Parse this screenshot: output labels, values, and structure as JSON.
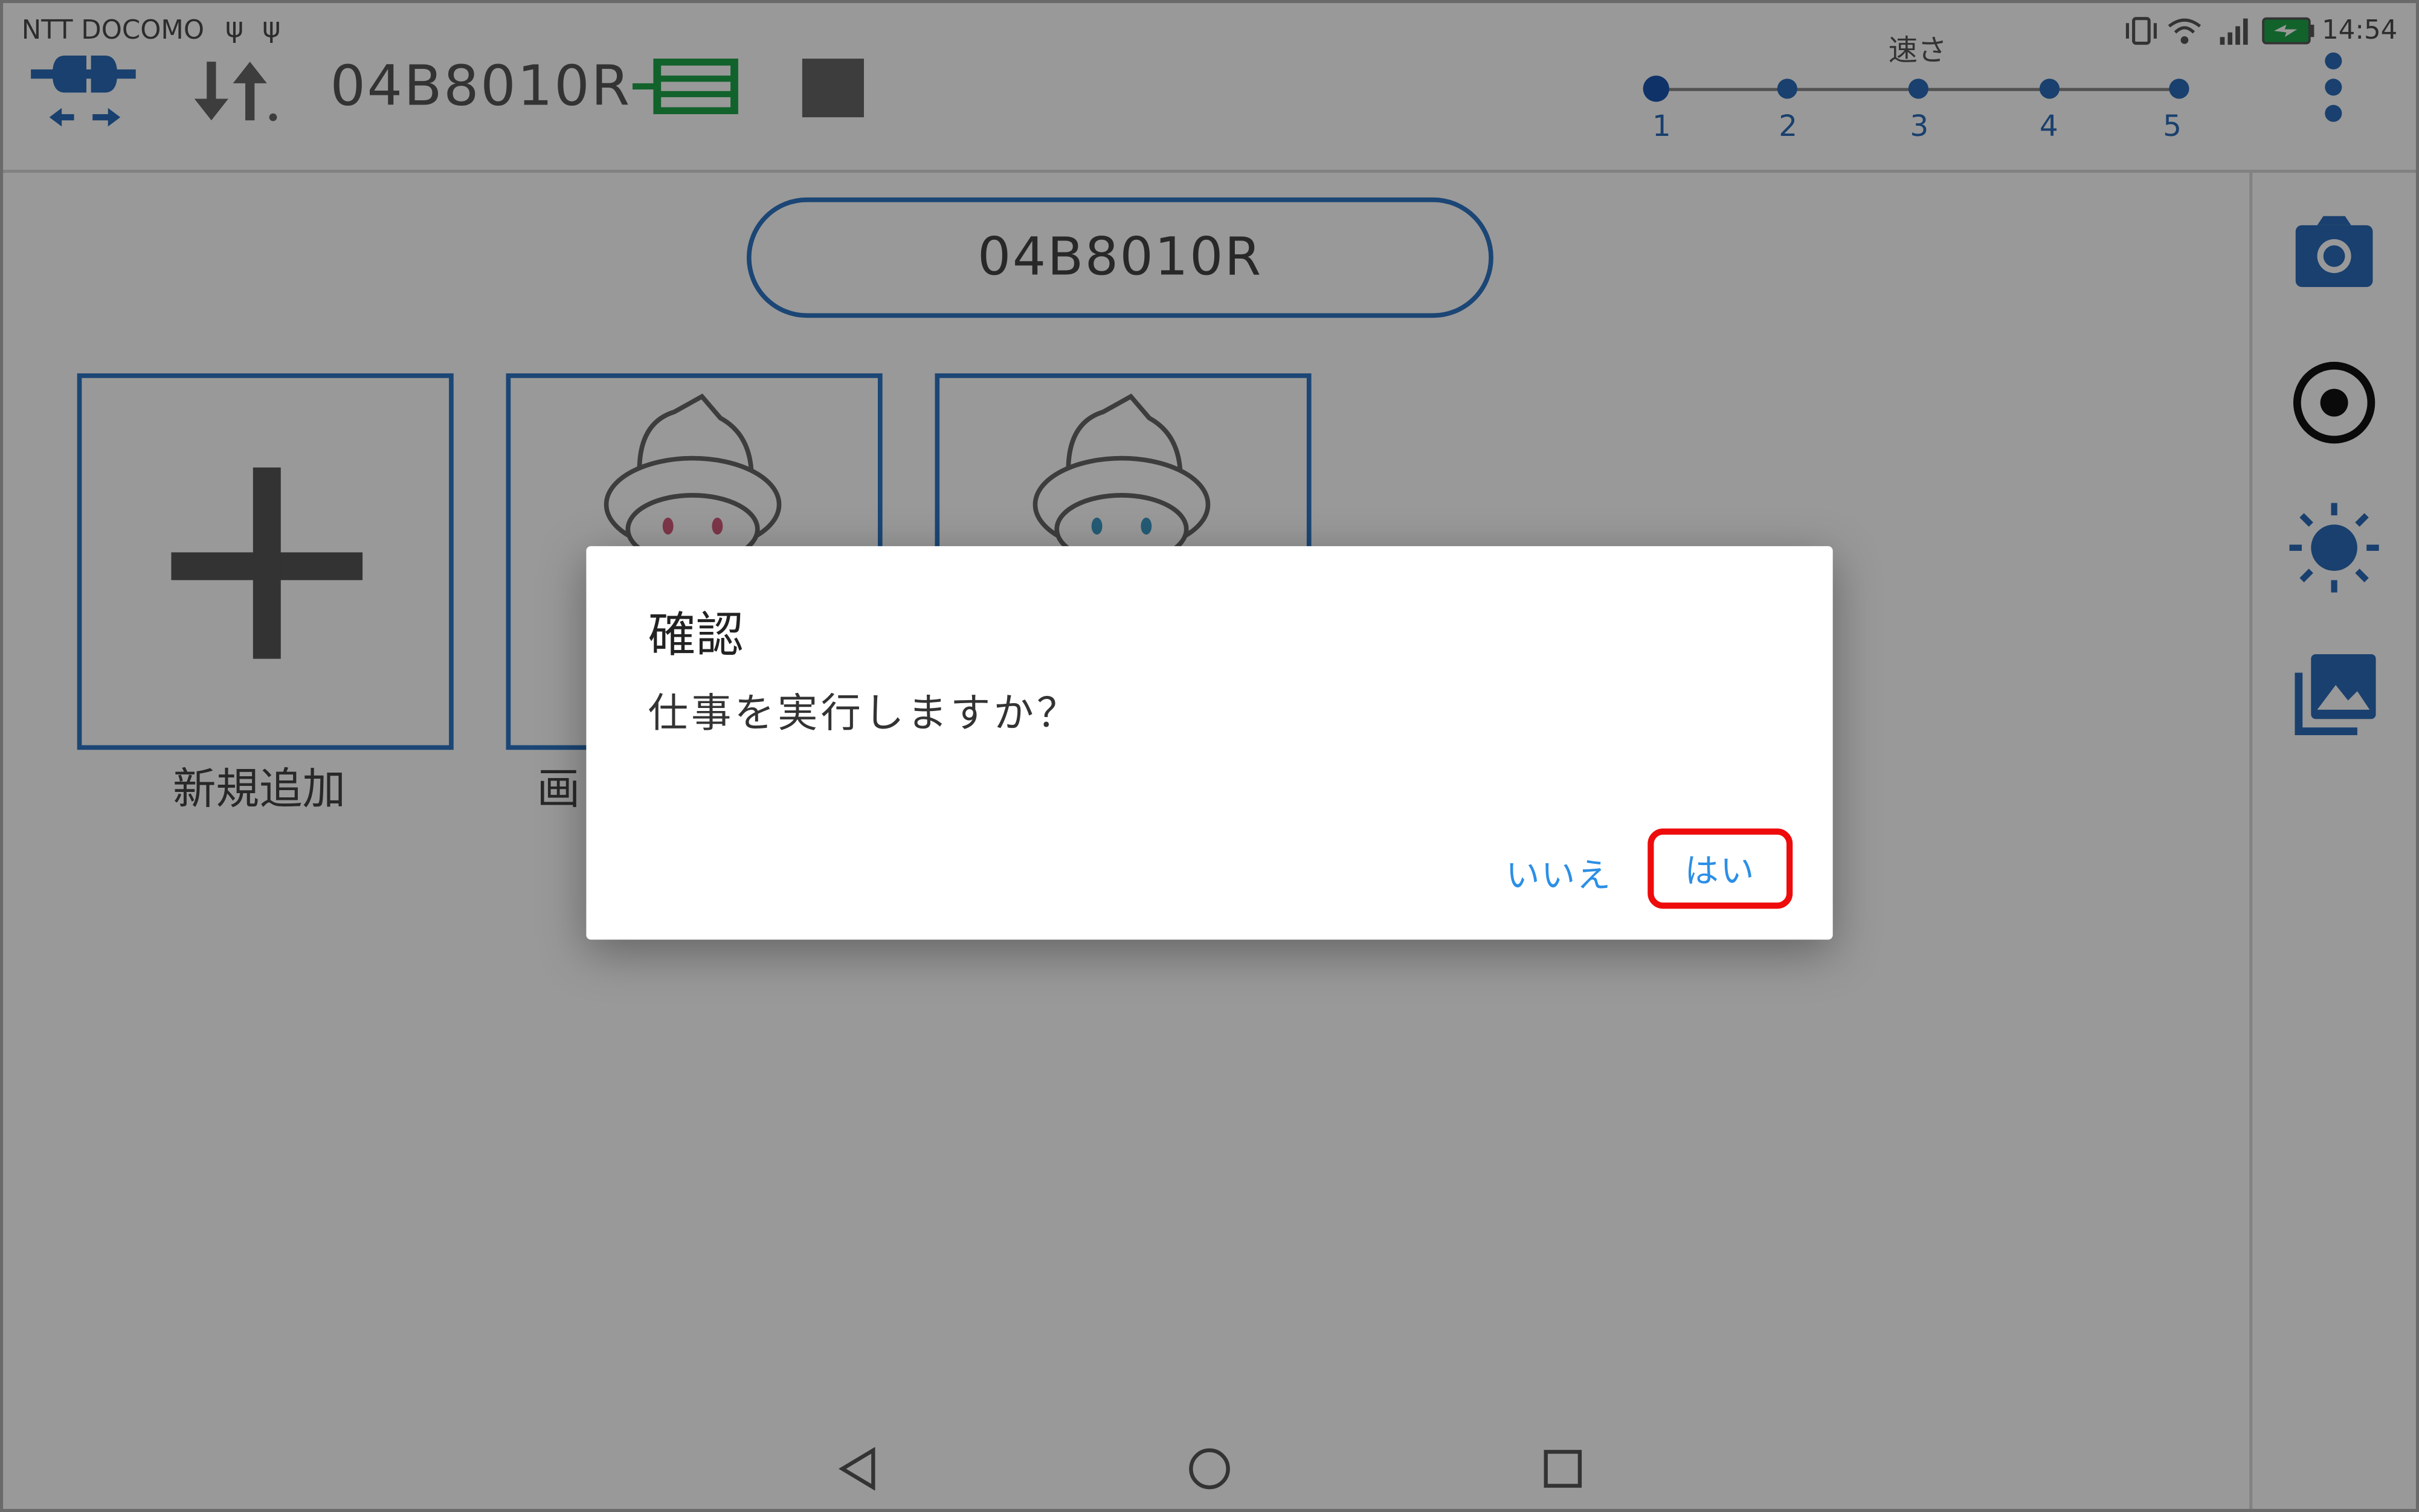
{
  "status_bar": {
    "carrier": "NTT DOCOMO",
    "usb_icons": [
      "usb-icon",
      "usb-icon"
    ],
    "right_icons": [
      "vibrate-icon",
      "wifi-icon",
      "signal-icon",
      "battery-charging-icon"
    ],
    "time": "14:54"
  },
  "toolbar": {
    "connection_icon": "plug-connect-icon",
    "sort_icon": "sort-updown-icon",
    "device_id": "04B8010R",
    "device_icon": "device-list-icon",
    "stop_icon": "stop-icon",
    "speed": {
      "label": "速さ",
      "levels": [
        "1",
        "2",
        "3",
        "4",
        "5"
      ],
      "selected": "1"
    },
    "menu_icon": "more-vert-icon"
  },
  "sidebar": {
    "buttons": [
      "camera-icon",
      "record-icon",
      "brightness-icon",
      "gallery-icon"
    ]
  },
  "main": {
    "name_field": "04B8010R",
    "tiles": [
      {
        "label": "新規追加",
        "icon": "plus-icon"
      },
      {
        "label": "画",
        "icon": "character-pink-icon"
      },
      {
        "label": "",
        "icon": "character-blue-icon"
      }
    ]
  },
  "nav_bar": {
    "buttons": [
      "back-icon",
      "home-icon",
      "recents-icon"
    ]
  },
  "dialog": {
    "title": "確認",
    "message": "仕事を実行しますか？",
    "no_label": "いいえ",
    "yes_label": "はい"
  },
  "colors": {
    "accent_blue": "#2e76c4",
    "dialog_button": "#2b8fe6",
    "highlight": "#ee0b0b",
    "device_green": "#1ea34a"
  }
}
